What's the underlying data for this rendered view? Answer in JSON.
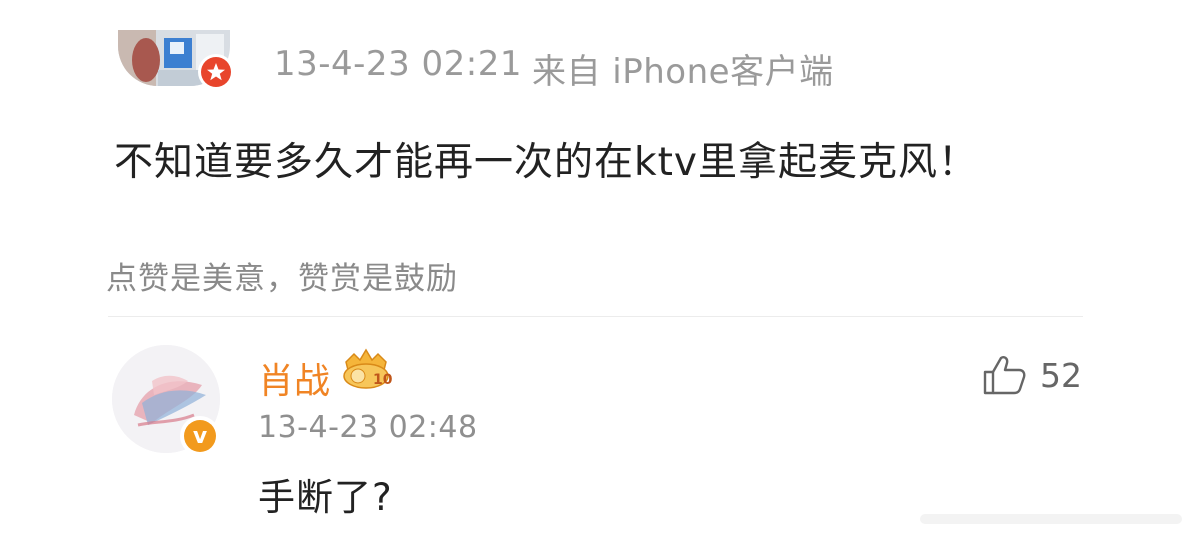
{
  "post": {
    "time": "13-4-23 02:21",
    "source": "来自 iPhone客户端",
    "content": "不知道要多久才能再一次的在ktv里拿起麦克风！",
    "hint": "点赞是美意，赞赏是鼓励"
  },
  "reply": {
    "username": "肖战",
    "verified_badge": "v",
    "level_badge": "10",
    "time": "13-4-23 02:48",
    "text": "手断了?",
    "like_count": "52"
  },
  "icons": {
    "post_badge": "red-star-badge-icon",
    "like": "thumbs-up-icon",
    "level": "crown-level-badge-icon"
  },
  "colors": {
    "username": "#f08424",
    "verified": "#f29a1d",
    "post_badge": "#e8452c",
    "meta_text": "#9a9a9a"
  }
}
